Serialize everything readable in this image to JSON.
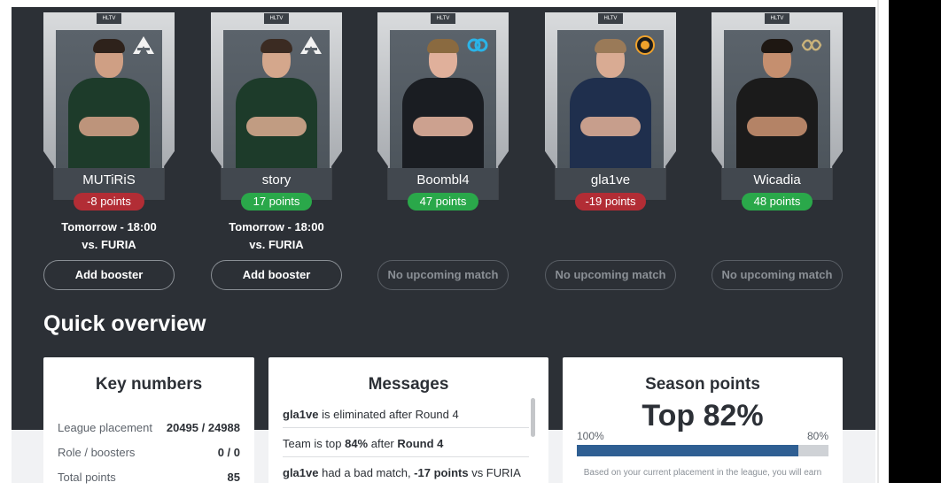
{
  "cards": [
    {
      "name": "MUTiRiS",
      "points": "-8 points",
      "points_sign": "neg",
      "match_line1": "Tomorrow - 18:00",
      "match_line2": "vs. FURIA",
      "button": "Add booster",
      "button_disabled": false,
      "team_icon": "sal-logo-icon",
      "jersey": "#1d3b2a",
      "skin": "#cf9f84",
      "hair": "#2e221b"
    },
    {
      "name": "story",
      "points": "17 points",
      "points_sign": "pos",
      "match_line1": "Tomorrow - 18:00",
      "match_line2": "vs. FURIA",
      "button": "Add booster",
      "button_disabled": false,
      "team_icon": "sal-logo-icon",
      "jersey": "#1d3b2a",
      "skin": "#d4a78c",
      "hair": "#3b2b22"
    },
    {
      "name": "Boombl4",
      "points": "47 points",
      "points_sign": "pos",
      "match_line1": "",
      "match_line2": "",
      "button": "No upcoming match",
      "button_disabled": true,
      "team_icon": "cloud9-logo-icon",
      "jersey": "#1a1d22",
      "skin": "#e0b09b",
      "hair": "#8a6a40"
    },
    {
      "name": "gla1ve",
      "points": "-19 points",
      "points_sign": "neg",
      "match_line1": "",
      "match_line2": "",
      "button": "No upcoming match",
      "button_disabled": true,
      "team_icon": "ence-logo-icon",
      "jersey": "#1f2f4d",
      "skin": "#d9ab93",
      "hair": "#9a7a58"
    },
    {
      "name": "Wicadia",
      "points": "48 points",
      "points_sign": "pos",
      "match_line1": "",
      "match_line2": "",
      "button": "No upcoming match",
      "button_disabled": true,
      "team_icon": "eternal-fire-logo-icon",
      "jersey": "#1b1b1b",
      "skin": "#c58f6f",
      "hair": "#1e1712"
    }
  ],
  "hltv_badge": "HLTV",
  "quick_overview_title": "Quick overview",
  "key_numbers": {
    "title": "Key numbers",
    "rows": [
      {
        "label": "League placement",
        "value": "20495 / 24988"
      },
      {
        "label": "Role / boosters",
        "value": "0 / 0"
      },
      {
        "label": "Total points",
        "value": "85"
      }
    ]
  },
  "messages": {
    "title": "Messages",
    "items": [
      {
        "bold_lead": "gla1ve",
        "text": " is eliminated after Round 4"
      },
      {
        "pre": "Team is top ",
        "bold1": "84%",
        "mid": " after ",
        "bold2": "Round 4"
      },
      {
        "bold_lead": "gla1ve",
        "text": " had a bad match, ",
        "bold_mid": "-17 points",
        "tail": " vs FURIA"
      }
    ]
  },
  "season_points": {
    "title": "Season points",
    "headline": "Top 82%",
    "left_pct": "100%",
    "right_pct": "80%",
    "fill_fraction": 0.88,
    "note": "Based on your current placement in the league, you will earn"
  },
  "colors": {
    "panel_dark": "#2c3036",
    "negative": "#b22d35",
    "positive": "#2aa84a",
    "progress": "#2f5f93"
  }
}
